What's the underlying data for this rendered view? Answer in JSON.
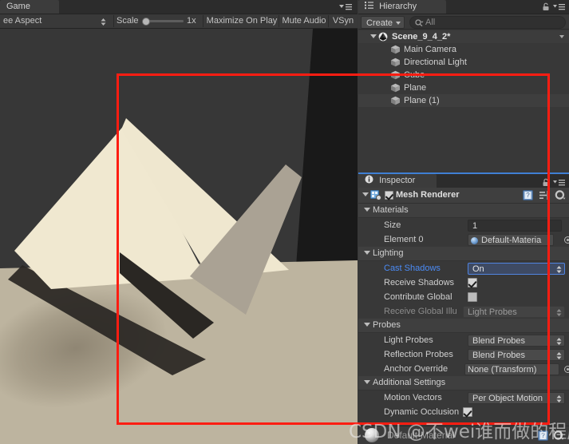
{
  "app": "Unity Editor",
  "game_panel": {
    "tab_label": "Game",
    "tab_menu_icon": "tab-menu-icon",
    "toolbar": {
      "aspect_value": "ee Aspect",
      "aspect_icon": "dropdown-arrows-icon",
      "scale_label": "Scale",
      "scale_value": "1x",
      "scale_slider_position": 1,
      "maximize_on_play": "Maximize On Play",
      "mute_audio": "Mute Audio",
      "vsync": "VSyn"
    },
    "scene_colors": {
      "background": "#373737",
      "dark_wall": "#191919",
      "ground": "#bdb49f",
      "cube_lit_face": "#efe7cf",
      "cube_side_face": "#aaa294",
      "cube_shadow": "#2a2723"
    },
    "annotation": {
      "name": "red-highlight-rectangle",
      "color": "#fd1d12"
    },
    "watermark": "CSDN @不wei谁而做的程序员"
  },
  "hierarchy": {
    "tab_label": "Hierarchy",
    "tab_icon": "hierarchy-icon",
    "lock_icon": "lock-icon",
    "menu_icon": "panel-menu-icon",
    "create_label": "Create",
    "search_placeholder": "All",
    "search_icon": "search-icon",
    "scene_name": "Scene_9_4_2*",
    "scene_icon": "unity-scene-icon",
    "objects": [
      {
        "label": "Main Camera",
        "icon": "gameobject-cube-icon"
      },
      {
        "label": "Directional Light",
        "icon": "gameobject-cube-icon"
      },
      {
        "label": "Cube",
        "icon": "gameobject-cube-icon"
      },
      {
        "label": "Plane",
        "icon": "gameobject-cube-icon"
      },
      {
        "label": "Plane (1)",
        "icon": "gameobject-cube-icon"
      }
    ]
  },
  "inspector": {
    "tab_label": "Inspector",
    "tab_icon": "info-icon",
    "lock_icon": "lock-icon",
    "menu_icon": "panel-menu-icon",
    "component": {
      "title": "Mesh Renderer",
      "icon": "mesh-renderer-icon",
      "enabled": true,
      "help_icon": "help-book-icon",
      "preset_icon": "preset-icon",
      "gear_icon": "gear-icon"
    },
    "sections": [
      {
        "name": "Materials",
        "label": "Materials",
        "rows": [
          {
            "label": "Size",
            "value": "1",
            "kind": "text"
          },
          {
            "label": "Element 0",
            "value": "Default-Materia",
            "kind": "object"
          }
        ]
      },
      {
        "name": "Lighting",
        "label": "Lighting",
        "rows": [
          {
            "label": "Cast Shadows",
            "value": "On",
            "kind": "dropdown-focused"
          },
          {
            "label": "Receive Shadows",
            "value": "",
            "kind": "checkbox-checked"
          },
          {
            "label": "Contribute Global",
            "value": "",
            "kind": "checkbox-empty"
          },
          {
            "label": "Receive Global Illu",
            "value": "Light Probes",
            "kind": "dropdown-disabled"
          }
        ]
      },
      {
        "name": "Probes",
        "label": "Probes",
        "rows": [
          {
            "label": "Light Probes",
            "value": "Blend Probes",
            "kind": "dropdown"
          },
          {
            "label": "Reflection Probes",
            "value": "Blend Probes",
            "kind": "dropdown"
          },
          {
            "label": "Anchor Override",
            "value": "None (Transform)",
            "kind": "object-plain"
          }
        ]
      },
      {
        "name": "Additional Settings",
        "label": "Additional Settings",
        "rows": [
          {
            "label": "Motion Vectors",
            "value": "Per Object Motion",
            "kind": "dropdown"
          },
          {
            "label": "Dynamic Occlusion",
            "value": "",
            "kind": "checkbox-checked"
          }
        ]
      }
    ],
    "footer": {
      "material_name": "Default-Material",
      "preview_icon": "material-sphere-icon",
      "help_icon": "help-book-icon",
      "gear_icon": "gear-icon"
    }
  }
}
